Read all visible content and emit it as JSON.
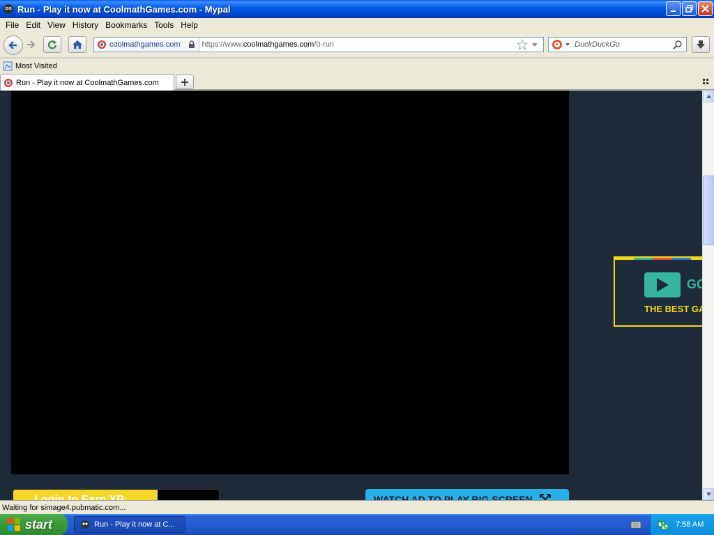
{
  "window": {
    "title": "Run - Play it now at CoolmathGames.com - Mypal"
  },
  "menu": [
    "File",
    "Edit",
    "View",
    "History",
    "Bookmarks",
    "Tools",
    "Help"
  ],
  "navbar": {
    "identity_label": "coolmathgames.com",
    "url_prefix": "https://www.",
    "url_host": "coolmathgames.com",
    "url_path": "/0-run",
    "search_placeholder": "DuckDuckGo"
  },
  "bookmarks": {
    "most_visited": "Most Visited"
  },
  "tabs": [
    {
      "label": "Run - Play it now at CoolmathGames.com"
    }
  ],
  "content": {
    "ad": {
      "word": "GO",
      "tagline": "THE BEST GA",
      "stripe_colors": [
        "#f0d91b",
        "#35b6a0",
        "#e84c3d",
        "#2d7bd8",
        "#f0d91b"
      ]
    },
    "login_button": "Login to Earn XP",
    "bigscreen_button": "WATCH AD TO PLAY BIG SCREEN"
  },
  "status": {
    "text": "Waiting for simage4.pubmatic.com..."
  },
  "taskbar": {
    "start_label": "start",
    "task_label": "Run - Play it now at C...",
    "clock": "7:58 AM"
  },
  "colors": {
    "page_bg": "#1f2a38",
    "accent_yellow": "#f0d91b",
    "accent_teal": "#35b6a0",
    "button_blue": "#27b0e8"
  }
}
